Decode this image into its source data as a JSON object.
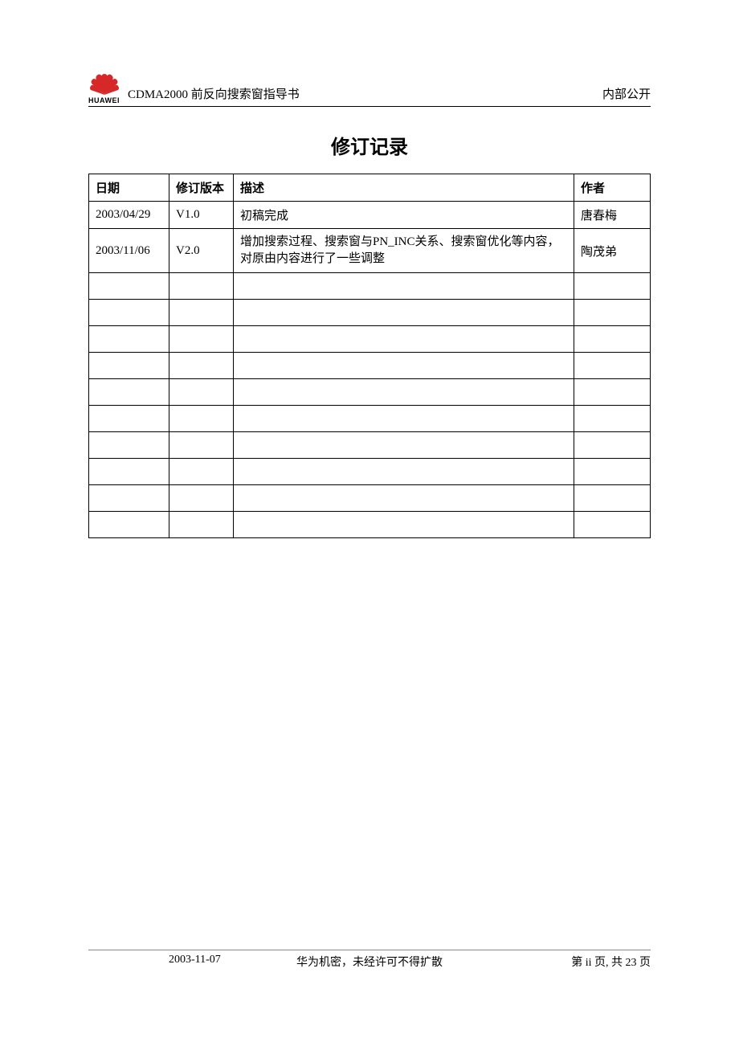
{
  "header": {
    "logo_label": "HUAWEI",
    "title": "CDMA2000 前反向搜索窗指导书",
    "tag": "内部公开"
  },
  "page_title": "修订记录",
  "table": {
    "headers": {
      "date": "日期",
      "version": "修订版本",
      "desc": "描述",
      "author": "作者"
    },
    "rows": [
      {
        "date": "2003/04/29",
        "version": "V1.0",
        "desc": "初稿完成",
        "author": "唐春梅"
      },
      {
        "date": "2003/11/06",
        "version": "V2.0",
        "desc": "增加搜索过程、搜索窗与PN_INC关系、搜索窗优化等内容，对原由内容进行了一些调整",
        "author": "陶茂弟"
      },
      {
        "date": "",
        "version": "",
        "desc": "",
        "author": ""
      },
      {
        "date": "",
        "version": "",
        "desc": "",
        "author": ""
      },
      {
        "date": "",
        "version": "",
        "desc": "",
        "author": ""
      },
      {
        "date": "",
        "version": "",
        "desc": "",
        "author": ""
      },
      {
        "date": "",
        "version": "",
        "desc": "",
        "author": ""
      },
      {
        "date": "",
        "version": "",
        "desc": "",
        "author": ""
      },
      {
        "date": "",
        "version": "",
        "desc": "",
        "author": ""
      },
      {
        "date": "",
        "version": "",
        "desc": "",
        "author": ""
      },
      {
        "date": "",
        "version": "",
        "desc": "",
        "author": ""
      },
      {
        "date": "",
        "version": "",
        "desc": "",
        "author": ""
      }
    ]
  },
  "footer": {
    "date": "2003-11-07",
    "center": "华为机密，未经许可不得扩散",
    "page": "第 ii 页, 共 23 页"
  }
}
